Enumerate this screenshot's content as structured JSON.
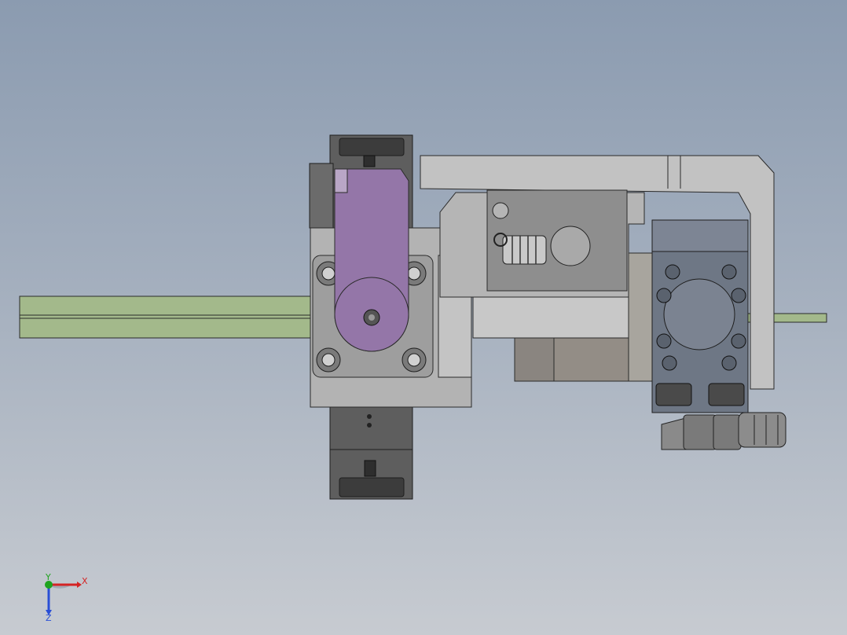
{
  "triad": {
    "x_label": "X",
    "y_label": "Y",
    "z_label": "Z",
    "colors": {
      "x": "#d42424",
      "y": "#1fa31f",
      "z": "#2a4fd6"
    }
  },
  "model": {
    "colors": {
      "rod": "#a3b98b",
      "lever": "#9476a8",
      "housing": "#a8a8a8",
      "dark_block": "#555555",
      "bracket": "#c2c2c2"
    }
  }
}
